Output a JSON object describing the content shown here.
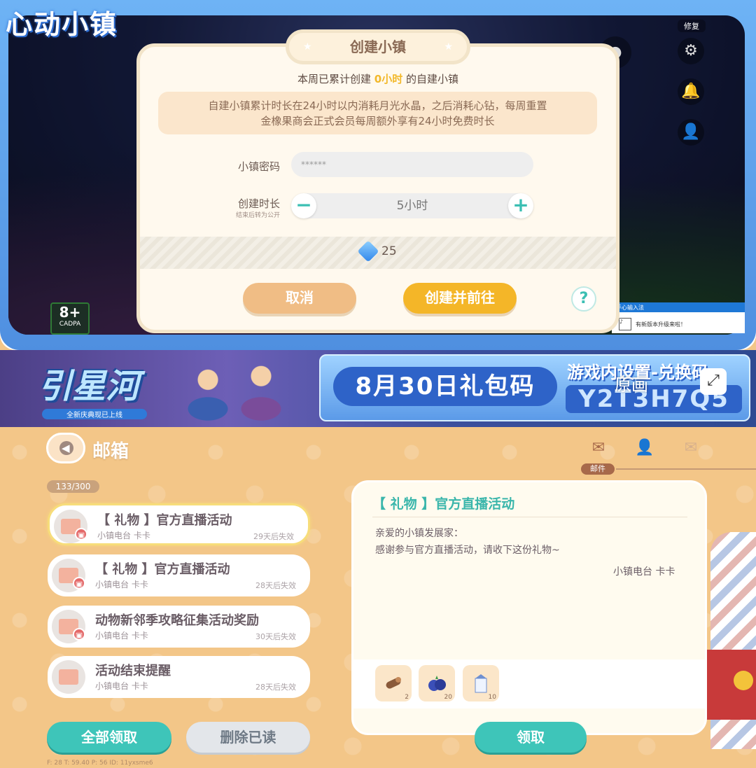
{
  "game": {
    "logo": "心动小镇",
    "repair_label": "修复",
    "rating": "8+",
    "rating_sub": "CADPA",
    "notify_header": "手心输入法",
    "notify_text": "有新版本升级来啦！"
  },
  "dialog": {
    "title": "创建小镇",
    "subtitle_pre": "本周已累计创建",
    "subtitle_value": "0小时",
    "subtitle_post": "的自建小镇",
    "info_line1": "自建小镇累计时长在24小时以内消耗月光水晶，之后消耗心钻，每周重置",
    "info_line2": "金橡果商会正式会员每周额外享有24小时免费时长",
    "password_label": "小镇密码",
    "password_value": "******",
    "duration_label": "创建时长",
    "duration_sub": "结束后转为公开",
    "duration_value": "5小时",
    "minus": "−",
    "plus": "+",
    "cost": "25",
    "cancel": "取消",
    "create": "创建并前往",
    "help": "?"
  },
  "banner": {
    "title": "引星河",
    "subtitle": "全新庆典现已上线",
    "date": "8月30日礼包码",
    "tip": "游戏内设置-兑换码",
    "code": "Y2T3H7Q5",
    "origin": "原画",
    "expand_icon": "⤢"
  },
  "mailbox": {
    "title": "邮箱",
    "back_icon": "◀",
    "count": "133/300",
    "tab_active_label": "邮件",
    "tabs": [
      {
        "icon": "✉"
      },
      {
        "icon": "👤"
      },
      {
        "icon": "✉"
      }
    ],
    "items": [
      {
        "title": "【 礼物 】官方直播活动",
        "sender": "小镇电台 卡卡",
        "expires": "29天后失效",
        "badge": "🎁"
      },
      {
        "title": "【 礼物 】官方直播活动",
        "sender": "小镇电台 卡卡",
        "expires": "28天后失效",
        "badge": "🎁"
      },
      {
        "title": "动物新邻季攻略征集活动奖励",
        "sender": "小镇电台 卡卡",
        "expires": "30天后失效",
        "badge": "🎁"
      },
      {
        "title": "活动结束提醒",
        "sender": "小镇电台 卡卡",
        "expires": "28天后失效",
        "badge": ""
      }
    ],
    "claim_all": "全部领取",
    "delete_read": "删除已读",
    "debug": "F: 28    T: 59.40    P: 56    ID: 11yxsme6",
    "letter": {
      "title": "【 礼物 】官方直播活动",
      "greeting": "亲爱的小镇发展家：",
      "body": "感谢参与官方直播活动，请收下这份礼物~",
      "signature": "小镇电台 卡卡",
      "attachments": [
        {
          "icon": "wood-log-icon",
          "count": "2"
        },
        {
          "icon": "blueberry-icon",
          "count": "20"
        },
        {
          "icon": "milk-carton-icon",
          "count": "10"
        }
      ],
      "claim": "领取"
    }
  },
  "colors": {
    "teal": "#3ec5b9",
    "gold": "#f4b628",
    "mail_bg": "#f3c688"
  }
}
